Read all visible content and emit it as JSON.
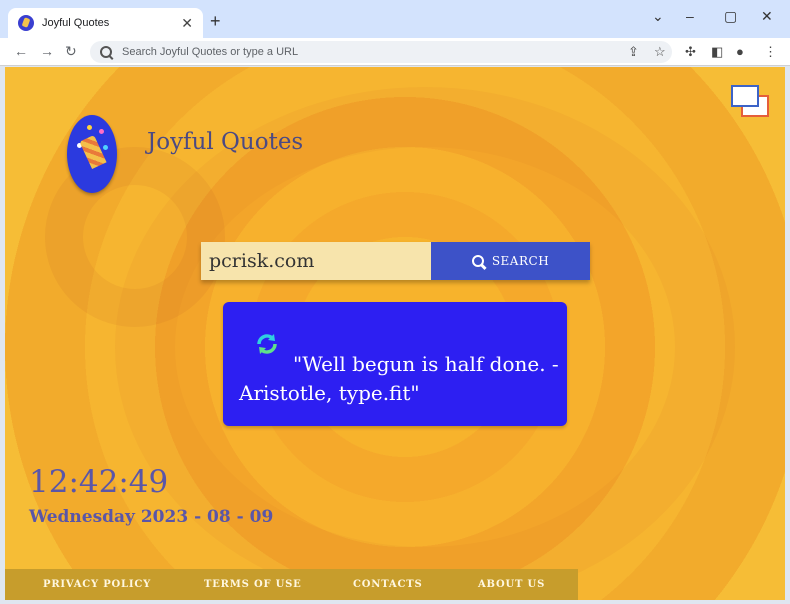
{
  "browser": {
    "tab_title": "Joyful Quotes",
    "new_tab_symbol": "+",
    "omnibox_placeholder": "Search Joyful Quotes or type a URL"
  },
  "page": {
    "brand": "Joyful Quotes",
    "search": {
      "value": "pcrisk.com",
      "button_label": "SEARCH"
    },
    "quote": "\"Well begun is half done. - Aristotle, type.fit\"",
    "clock": {
      "time": "12:42:49",
      "date": "Wednesday 2023 - 08 - 09"
    },
    "footer": {
      "links": [
        "PRIVACY POLICY",
        "TERMS OF USE",
        "CONTACTS",
        "ABOUT US"
      ]
    }
  },
  "colors": {
    "accent_blue": "#3d52c8",
    "quote_bg": "#2d1ff2",
    "text_purple": "#5a56a8",
    "footer_bg": "#c79d2c",
    "page_bg": "#f6b530"
  },
  "icons": [
    "search-icon",
    "refresh-icon",
    "party-popper-logo",
    "image-swap-icon"
  ]
}
